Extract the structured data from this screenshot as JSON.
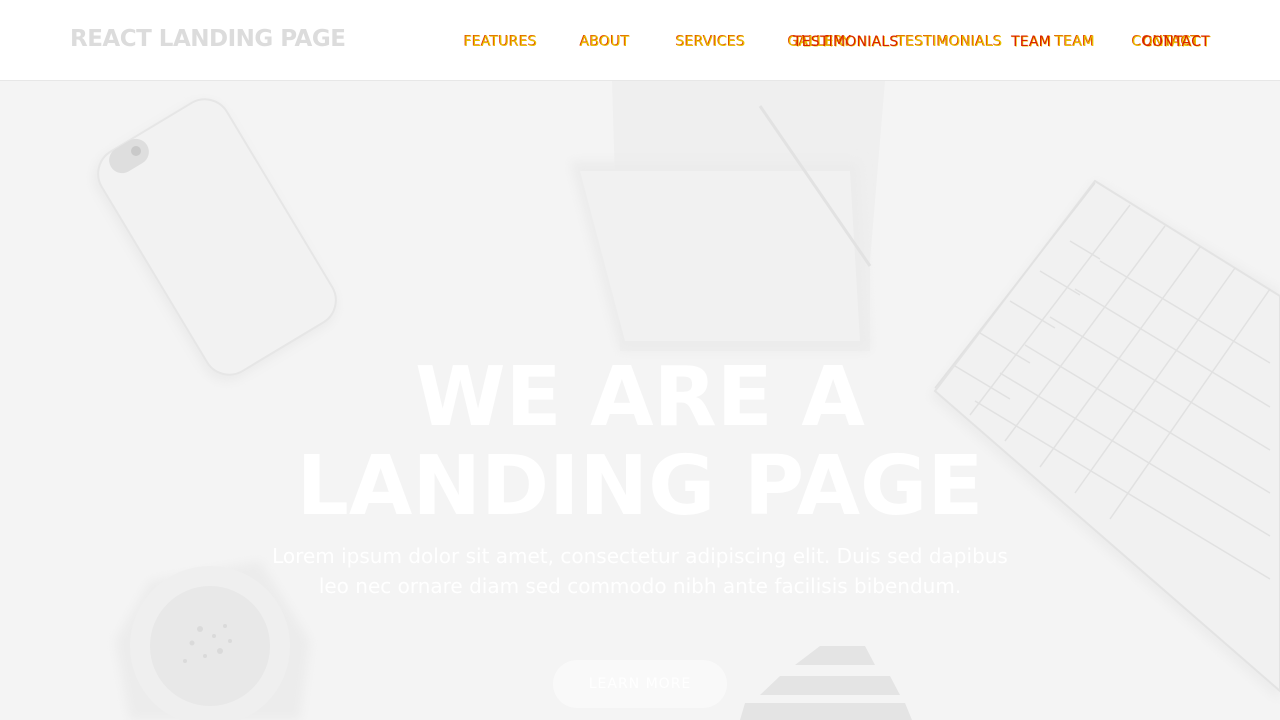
{
  "brand": {
    "title": "REACT LANDING PAGE"
  },
  "nav": {
    "items": [
      {
        "label": "FEATURES"
      },
      {
        "label": "ABOUT"
      },
      {
        "label": "SERVICES"
      },
      {
        "label": "GALLERY"
      },
      {
        "label": "TESTIMONIALS"
      },
      {
        "label": "TEAM"
      },
      {
        "label": "CONTACT"
      }
    ],
    "ghost_items": [
      {
        "label": "TESTIMONIALS"
      },
      {
        "label": "TEAM"
      },
      {
        "label": "CONTACT"
      }
    ]
  },
  "hero": {
    "title_line1": "WE ARE A",
    "title_line2": "LANDING PAGE",
    "subtitle": "Lorem ipsum dolor sit amet, consectetur adipiscing elit. Duis sed dapibus leo nec ornare diam sed commodo nibh ante facilisis bibendum.",
    "button_label": "LEARN MORE"
  },
  "colors": {
    "nav_link": "#e8c000",
    "nav_link_shadow": "#e03000",
    "brand": "#dcdcdc",
    "hero_text": "#ffffff"
  }
}
